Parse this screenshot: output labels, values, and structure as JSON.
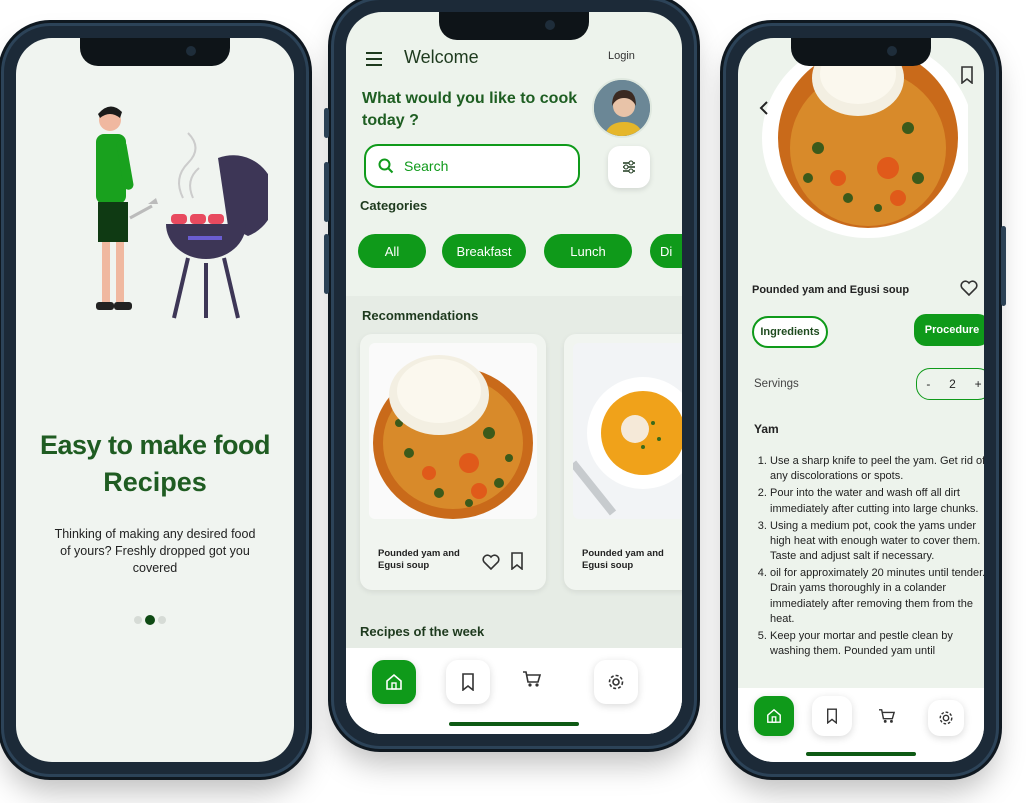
{
  "onboarding": {
    "headline_line1": "Easy to make food",
    "headline_line2": "Recipes",
    "subtitle": "Thinking of making any desired food of yours? Freshly dropped got you covered"
  },
  "home": {
    "welcome": "Welcome",
    "login": "Login",
    "prompt": "What would you like to cook today ?",
    "search_placeholder": "Search",
    "categories_title": "Categories",
    "categories": [
      "All",
      "Breakfast",
      "Lunch",
      "Di"
    ],
    "recommendations_title": "Recommendations",
    "recommendations": [
      {
        "name": "Pounded yam and Egusi soup"
      },
      {
        "name": "Pounded yam and Egusi soup"
      }
    ],
    "week_title": "Recipes of the week"
  },
  "detail": {
    "title": "Pounded yam and Egusi soup",
    "tab_ingredients": "Ingredients",
    "tab_procedure": "Procedure",
    "servings_label": "Servings",
    "servings_minus": "-",
    "servings_value": "2",
    "servings_plus": "+",
    "section": "Yam",
    "steps": [
      "Use a sharp knife to peel the yam. Get rid of any discolorations or spots.",
      "Pour into the water and wash off all dirt immediately after cutting into large chunks.",
      "Using a medium pot, cook the yams under high heat with enough water to cover them. Taste and adjust salt if necessary.",
      "oil for approximately 20 minutes until tender. Drain yams thoroughly in a colander immediately after removing them from the heat.",
      "Keep your mortar and pestle clean by washing them. Pounded yam until"
    ]
  },
  "colors": {
    "accent": "#0f9a1a",
    "dark_green": "#1e6b22",
    "screen_bg": "#edf3ec"
  }
}
